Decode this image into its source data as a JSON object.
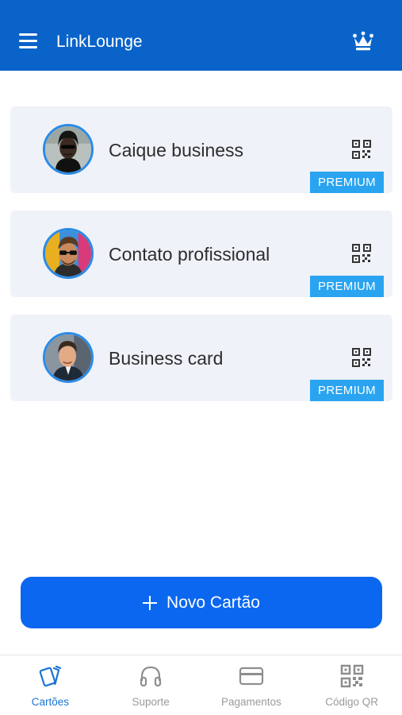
{
  "header": {
    "title": "LinkLounge",
    "menu_icon": "hamburger-menu-icon",
    "premium_icon": "crown-icon",
    "background": "#0a63c9"
  },
  "cards": [
    {
      "name": "Caique business",
      "badge": "PREMIUM",
      "avatar": "avatar-person-dark-hood",
      "qr_icon": "qr-code-icon"
    },
    {
      "name": "Contato profissional",
      "badge": "PREMIUM",
      "avatar": "avatar-man-sunglasses",
      "qr_icon": "qr-code-icon"
    },
    {
      "name": "Business card",
      "badge": "PREMIUM",
      "avatar": "avatar-man-suit",
      "qr_icon": "qr-code-icon"
    }
  ],
  "new_card_button": {
    "label": "Novo Cartão",
    "icon": "plus-icon",
    "color": "#0b67f0"
  },
  "bottom_nav": {
    "active": "Cartões",
    "accent": "#1a73d6",
    "items": [
      {
        "label": "Cartões",
        "icon": "cards-icon"
      },
      {
        "label": "Suporte",
        "icon": "headphones-icon"
      },
      {
        "label": "Pagamentos",
        "icon": "credit-card-icon"
      },
      {
        "label": "Código QR",
        "icon": "qr-code-icon"
      }
    ]
  }
}
